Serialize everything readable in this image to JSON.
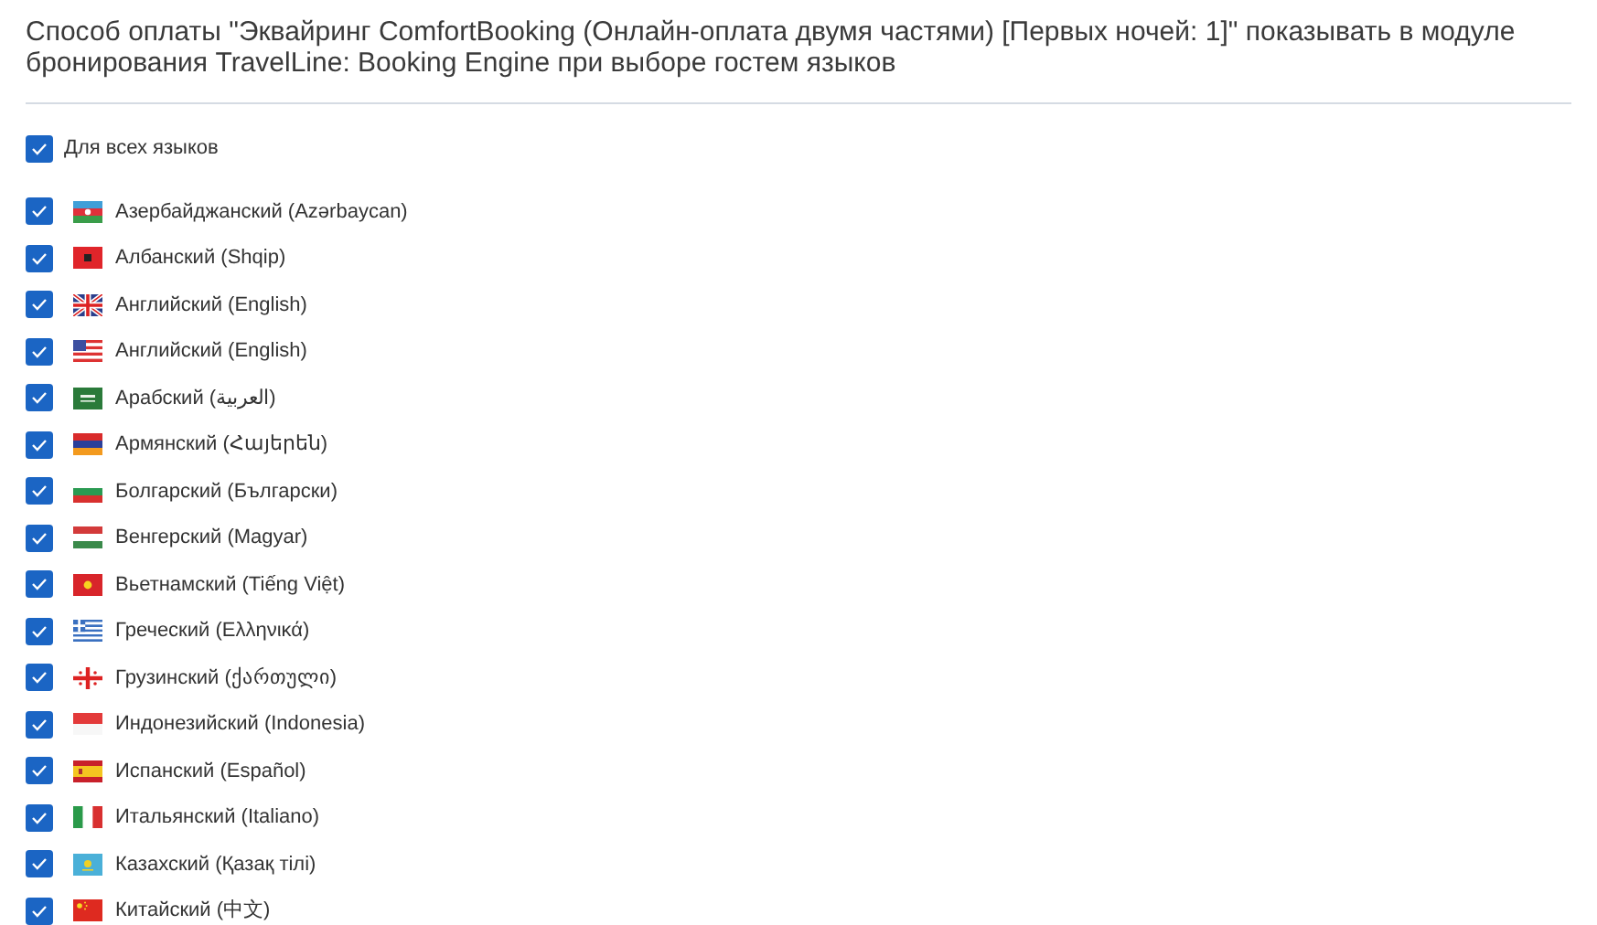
{
  "title": "Способ оплаты \"Эквайринг ComfortBooking (Онлайн-оплата двумя частями) [Первых ночей: 1]\" показывать в модуле бронирования TravelLine: Booking Engine при выборе гостем языков",
  "all_languages": {
    "label": "Для всех языков",
    "checked": true
  },
  "languages": [
    {
      "label": "Азербайджанский (Azərbaycan)",
      "checked": true
    },
    {
      "label": "Албанский (Shqip)",
      "checked": true
    },
    {
      "label": "Английский (English)",
      "checked": true
    },
    {
      "label": "Английский (English)",
      "checked": true
    },
    {
      "label": "Арабский (العربية)",
      "checked": true
    },
    {
      "label": "Армянский (Հայերեն)",
      "checked": true
    },
    {
      "label": "Болгарский (Български)",
      "checked": true
    },
    {
      "label": "Венгерский (Magyar)",
      "checked": true
    },
    {
      "label": "Вьетнамский (Tiếng Việt)",
      "checked": true
    },
    {
      "label": "Греческий (Ελληνικά)",
      "checked": true
    },
    {
      "label": "Грузинский (ქართული)",
      "checked": true
    },
    {
      "label": "Индонезийский (Indonesia)",
      "checked": true
    },
    {
      "label": "Испанский (Español)",
      "checked": true
    },
    {
      "label": "Итальянский (Italiano)",
      "checked": true
    },
    {
      "label": "Казахский (Қазақ тілі)",
      "checked": true
    },
    {
      "label": "Китайский (中文)",
      "checked": true
    }
  ]
}
